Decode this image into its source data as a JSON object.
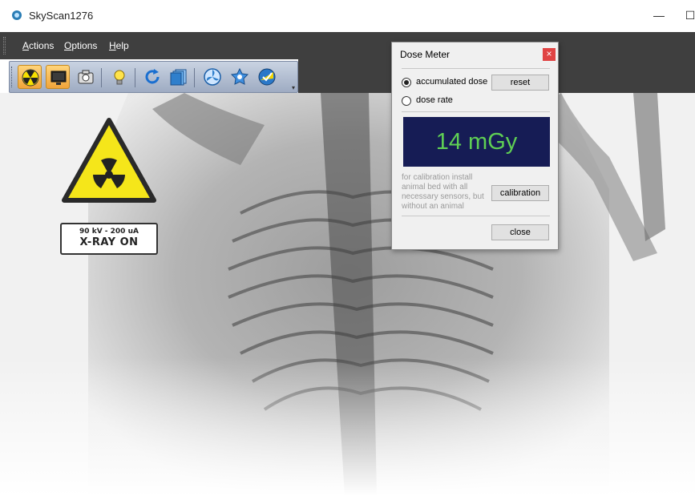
{
  "window": {
    "title": "SkyScan1276",
    "minimize_label": "—",
    "maximize_label": "☐"
  },
  "menu": {
    "items": [
      "Actions",
      "Options",
      "Help"
    ]
  },
  "toolbar": {
    "buttons": [
      "radiation-icon",
      "monitor-icon",
      "camera-icon",
      "lightbulb-icon",
      "refresh-icon",
      "scan-frames-icon",
      "fan-icon",
      "gear-cycle-icon",
      "shield-check-icon"
    ],
    "more_label": "▾"
  },
  "status_overlay": {
    "line1": "90 kV - 200 uA",
    "line2": "X-RAY ON"
  },
  "dose_meter": {
    "title": "Dose Meter",
    "close_label": "×",
    "options": [
      {
        "label": "accumulated dose",
        "selected": true
      },
      {
        "label": "dose rate",
        "selected": false
      }
    ],
    "reset_label": "reset",
    "dose_value": "14 mGy",
    "calibration_note": "for calibration install animal bed with all necessary sensors, but without an animal",
    "calibration_label": "calibration",
    "close_button_label": "close"
  },
  "colors": {
    "menubar": "#3f3f3f",
    "display_bg": "#161c55",
    "display_text": "#5fcf54",
    "warning_yellow": "#f5e61a",
    "toolbar_active": "#f0a43a"
  }
}
